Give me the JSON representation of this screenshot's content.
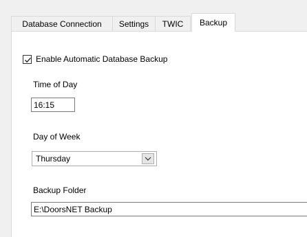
{
  "tabs": [
    {
      "label": "Database Connection"
    },
    {
      "label": "Settings"
    },
    {
      "label": "TWIC"
    },
    {
      "label": "Backup"
    }
  ],
  "backup": {
    "enable_label": "Enable Automatic Database Backup",
    "enable_checked": true,
    "time_label": "Time of Day",
    "time_value": "16:15",
    "day_label": "Day of Week",
    "day_value": "Thursday",
    "folder_label": "Backup Folder",
    "folder_value": "E:\\DoorsNET Backup"
  },
  "icons": {
    "checkmark": "check-icon",
    "dropdown": "chevron-down-icon"
  }
}
